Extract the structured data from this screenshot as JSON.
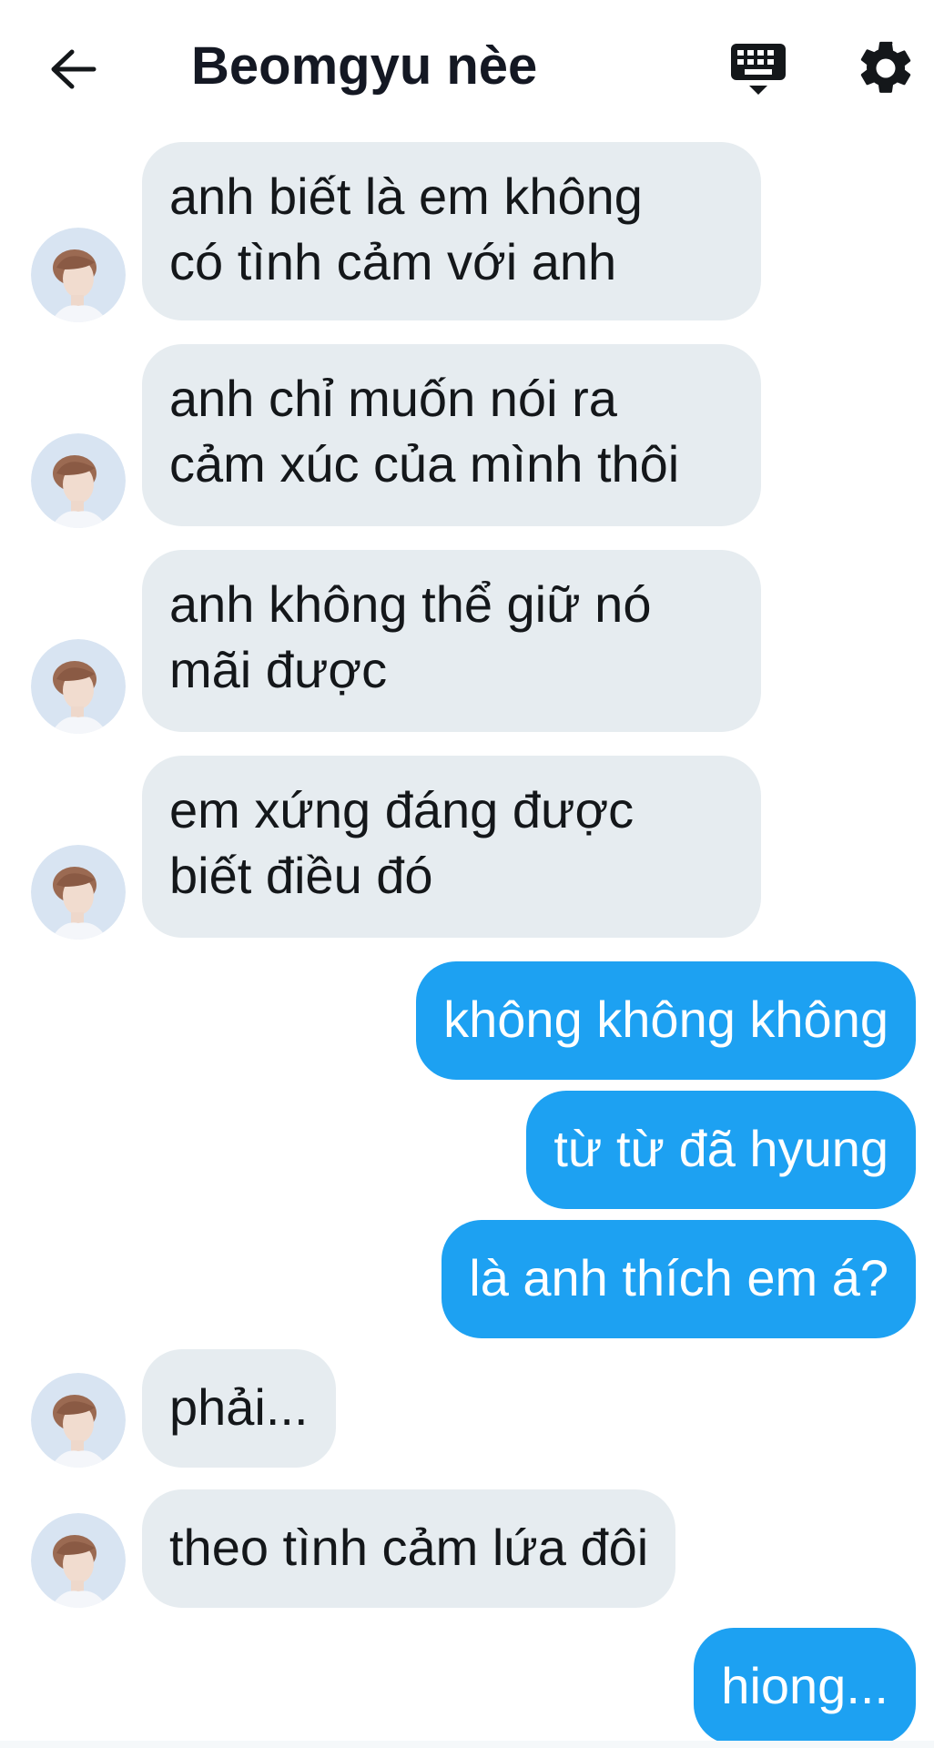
{
  "header": {
    "back_icon": "arrow-left-icon",
    "title": "Beomgyu nèe",
    "keyboard_icon": "keyboard-icon",
    "settings_icon": "gear-icon"
  },
  "colors": {
    "incoming_bubble": "#e6ecf0",
    "outgoing_bubble": "#1da1f2",
    "text_dark": "#14171a"
  },
  "messages": [
    {
      "direction": "incoming",
      "text": "anh biết là em không\ncó tình cảm với anh"
    },
    {
      "direction": "incoming",
      "text": "anh chỉ muốn nói ra\ncảm xúc của mình thôi"
    },
    {
      "direction": "incoming",
      "text": "anh không thể giữ nó\nmãi được"
    },
    {
      "direction": "incoming",
      "text": "em xứng đáng được\nbiết điều đó"
    },
    {
      "direction": "outgoing",
      "text": "không không không"
    },
    {
      "direction": "outgoing",
      "text": "từ từ đã hyung"
    },
    {
      "direction": "outgoing",
      "text": "là anh thích em á?"
    },
    {
      "direction": "incoming",
      "text": "phải..."
    },
    {
      "direction": "incoming",
      "text": "theo tình cảm lứa đôi"
    },
    {
      "direction": "outgoing",
      "text": "hiong..."
    }
  ]
}
